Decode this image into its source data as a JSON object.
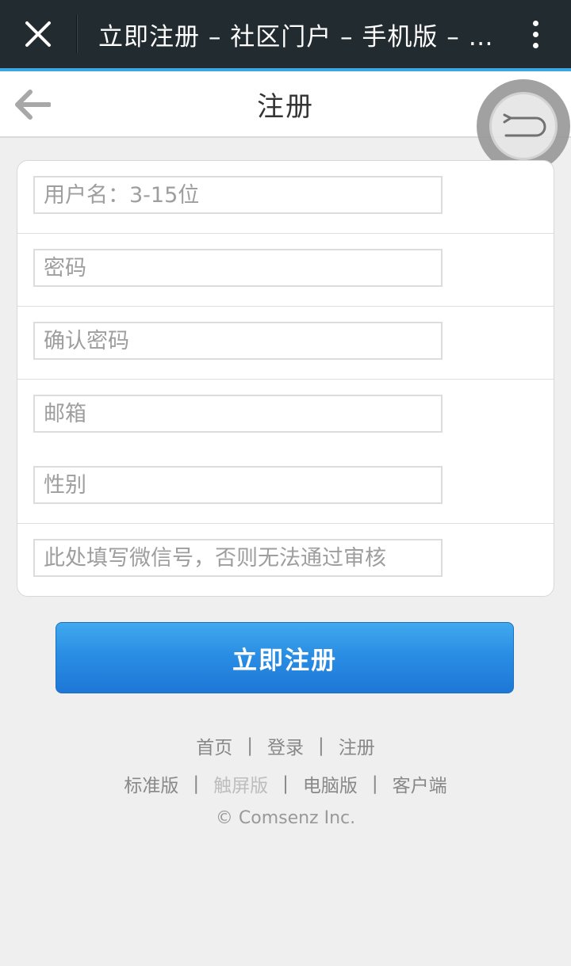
{
  "browser": {
    "title": "立即注册 – 社区门户 – 手机版 – Powered by Discuz!"
  },
  "header": {
    "title": "注册"
  },
  "form": {
    "username_placeholder": "用户名：3-15位",
    "password_placeholder": "密码",
    "confirm_placeholder": "确认密码",
    "email_placeholder": "邮箱",
    "gender_placeholder": "性别",
    "wechat_placeholder": "此处填写微信号，否则无法通过审核",
    "submit_label": "立即注册"
  },
  "footer": {
    "nav": [
      "首页",
      "登录",
      "注册"
    ],
    "versions": [
      "标准版",
      "触屏版",
      "电脑版",
      "客户端"
    ],
    "copyright": "© Comsenz Inc."
  },
  "colors": {
    "titlebar": "#222b30",
    "accent": "#3aa6e2",
    "button": "#2a8ee4"
  }
}
